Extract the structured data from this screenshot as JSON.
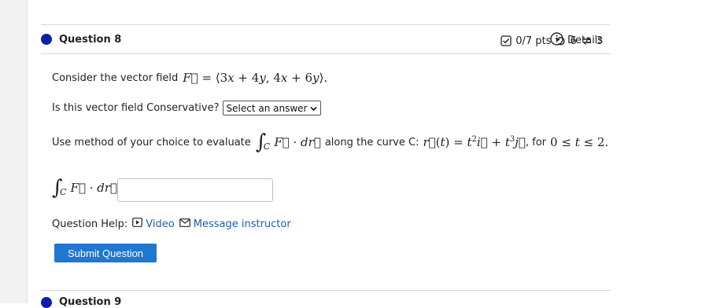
{
  "question": {
    "title": "Question 8",
    "points": "0/7 pts",
    "attempts": "6",
    "retries": "3",
    "details_label": "Details"
  },
  "prompt": {
    "line1_text": "Consider the vector field",
    "line2_text": "Is this vector field Conservative?",
    "select_value": "Select an answer",
    "line3_text": "Use method of your choice to evaluate",
    "line3_along": "along the curve C:",
    "line3_for": ", for"
  },
  "help": {
    "label": "Question Help:",
    "video": "Video",
    "message": "Message instructor"
  },
  "submit_label": "Submit Question",
  "next_question": {
    "title": "Question 9"
  },
  "colors": {
    "accent_blue": "#1f77d0",
    "dot_blue": "#0d1fa8",
    "link_blue": "#1a5fb4"
  }
}
